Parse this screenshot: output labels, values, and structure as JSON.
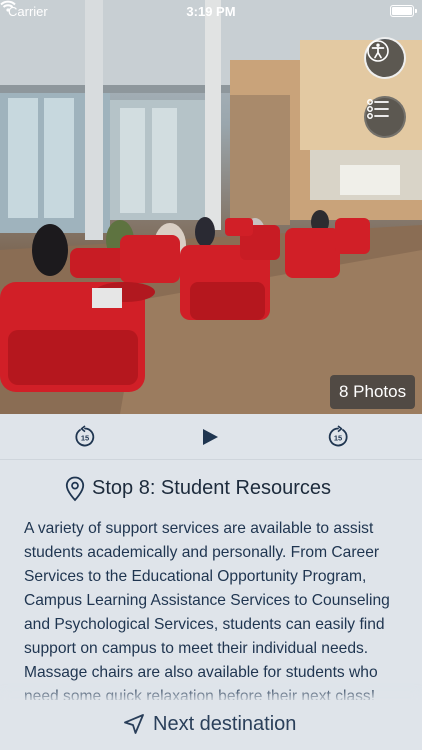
{
  "status_bar": {
    "carrier": "Carrier",
    "time": "3:19 PM"
  },
  "hero": {
    "photos_badge": "8 Photos",
    "accessibility_icon": "accessibility-icon",
    "list_icon": "list-icon"
  },
  "audio": {
    "back_icon": "rewind-15-icon",
    "back_seconds": "15",
    "play_icon": "play-icon",
    "forward_icon": "forward-15-icon",
    "forward_seconds": "15"
  },
  "stop": {
    "title": "Stop 8: Student Resources",
    "pin_icon": "map-pin-icon",
    "description": "A variety of support services are available to assist students academically and personally. From Career Services to the Educational Opportunity Program, Campus Learning Assistance Services to Counseling and Psychological Services, students can easily find support on campus to meet their individual needs. Massage chairs are also available for students who need some quick relaxation before their next class!"
  },
  "footer": {
    "next_label": "Next destination",
    "next_icon": "navigation-arrow-icon"
  },
  "colors": {
    "background": "#dfe4ea",
    "text_primary": "#1d2b3c",
    "text_body": "#1f3550",
    "accent": "#2a3f5a",
    "chair_red": "#d11f27"
  }
}
